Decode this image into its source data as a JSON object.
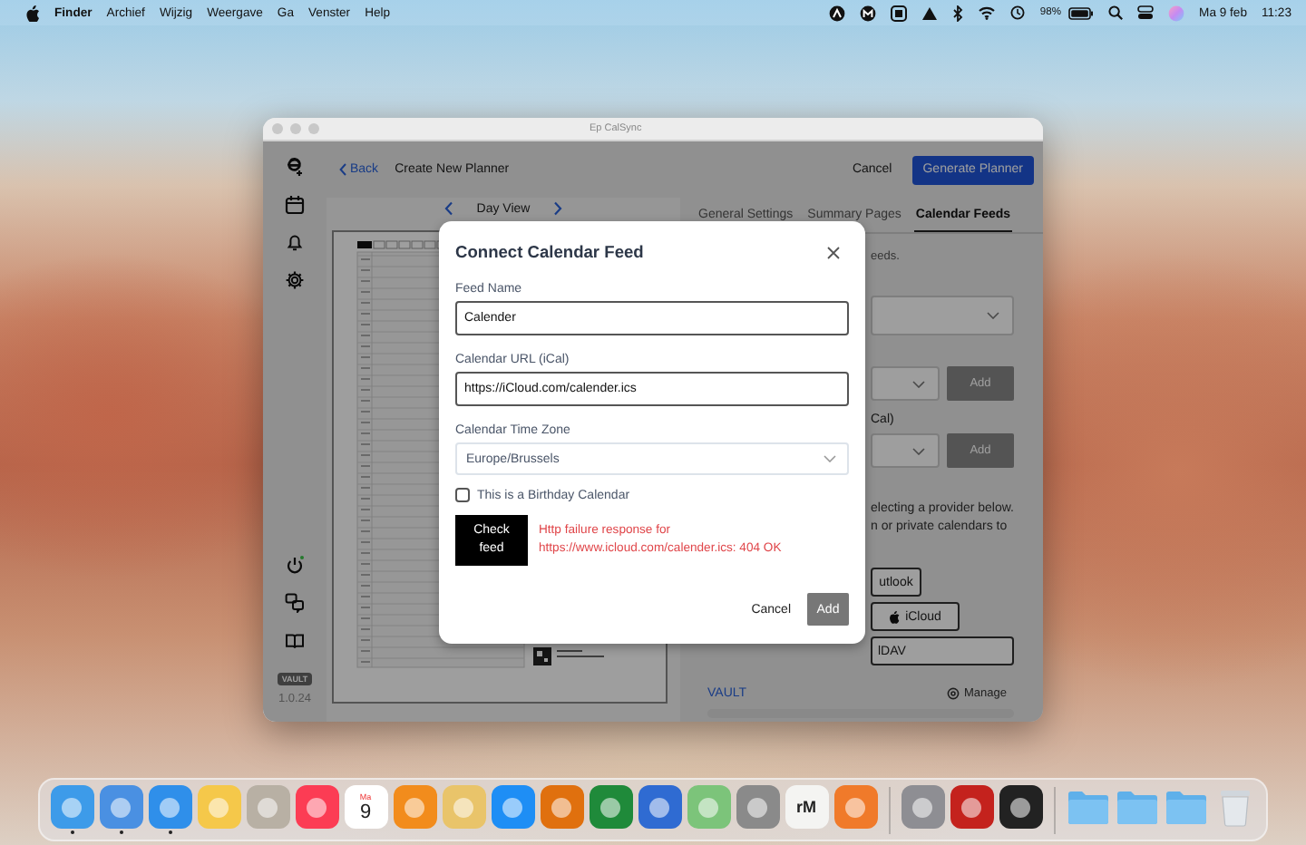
{
  "menu_bar": {
    "app": "Finder",
    "menus": [
      "Archief",
      "Wijzig",
      "Weergave",
      "Ga",
      "Venster",
      "Help"
    ],
    "battery": "98%",
    "date": "Ma 9 feb",
    "time": "11:23"
  },
  "window": {
    "title": "Ep CalSync",
    "sidebar": {
      "badge": "VAULT",
      "version": "1.0.24"
    },
    "header": {
      "back": "Back",
      "title": "Create New Planner",
      "cancel": "Cancel",
      "primary": "Generate Planner"
    },
    "preview": {
      "view": "Day View"
    },
    "tabs": [
      {
        "label": "General Settings",
        "selected": false
      },
      {
        "label": "Summary Pages",
        "selected": false
      },
      {
        "label": "Calendar Feeds",
        "selected": true
      }
    ],
    "feeds_panel": {
      "intro": "eeds.",
      "ical_label": "Cal)",
      "add_buttons": [
        "Add",
        "Add"
      ],
      "hint_lines": [
        "electing a provider below.",
        "n or private calendars to"
      ],
      "providers": [
        {
          "kind": "plain",
          "label": "utlook"
        },
        {
          "kind": "apple",
          "label": "iCloud"
        },
        {
          "kind": "plain",
          "label": "lDAV"
        }
      ],
      "vault": "VAULT",
      "manage": "Manage",
      "usage_bar": {
        "level": 0
      }
    },
    "dialog": {
      "title": "Connect Calendar Feed",
      "fields": [
        {
          "label": "Feed Name",
          "value": "Calender"
        },
        {
          "label": "Calendar URL (iCal)",
          "value": "https://iCloud.com/calender.ics"
        }
      ],
      "timezone": {
        "label": "Calendar Time Zone",
        "value": "Europe/Brussels"
      },
      "birthday": {
        "label": "This is a Birthday Calendar",
        "checked": false
      },
      "check_button": "Check feed",
      "error": "Http failure response for https://www.icloud.com/calender.ics: 404 OK",
      "cancel": "Cancel",
      "add": {
        "label": "Add",
        "disabled": true
      }
    }
  },
  "dock": [
    {
      "kind": "app",
      "color": "#3d9be9",
      "running": true
    },
    {
      "kind": "app",
      "color": "#4a90e2",
      "running": true
    },
    {
      "kind": "app",
      "color": "#2f8fea",
      "running": true
    },
    {
      "kind": "app",
      "color": "#f5c84a",
      "running": false
    },
    {
      "kind": "app",
      "color": "#b8b0a4",
      "running": false
    },
    {
      "kind": "app",
      "color": "#fc3c54",
      "running": false
    },
    {
      "kind": "calendar",
      "month": "Ma",
      "day": "9",
      "running": false
    },
    {
      "kind": "app",
      "color": "#f28c1c",
      "running": false
    },
    {
      "kind": "app",
      "color": "#e9c46a",
      "running": false
    },
    {
      "kind": "app",
      "color": "#1e8ef5",
      "running": false
    },
    {
      "kind": "app",
      "color": "#e0700e",
      "running": false
    },
    {
      "kind": "app",
      "color": "#1f8a3a",
      "running": false
    },
    {
      "kind": "app",
      "color": "#2f6bd2",
      "running": false
    },
    {
      "kind": "app",
      "color": "#7cc47a",
      "running": false
    },
    {
      "kind": "app",
      "color": "#8a8a8a",
      "running": false
    },
    {
      "kind": "lettered",
      "label": "rM",
      "running": false
    },
    {
      "kind": "app",
      "color": "#f07a2a",
      "running": false
    },
    {
      "kind": "separator"
    },
    {
      "kind": "app",
      "color": "#8e8e93",
      "running": false
    },
    {
      "kind": "app",
      "color": "#c4221d",
      "running": false
    },
    {
      "kind": "app",
      "color": "#222222",
      "running": false
    },
    {
      "kind": "separator"
    },
    {
      "kind": "folder",
      "running": false
    },
    {
      "kind": "folder",
      "running": false
    },
    {
      "kind": "folder",
      "running": false
    },
    {
      "kind": "trash",
      "running": false
    }
  ]
}
